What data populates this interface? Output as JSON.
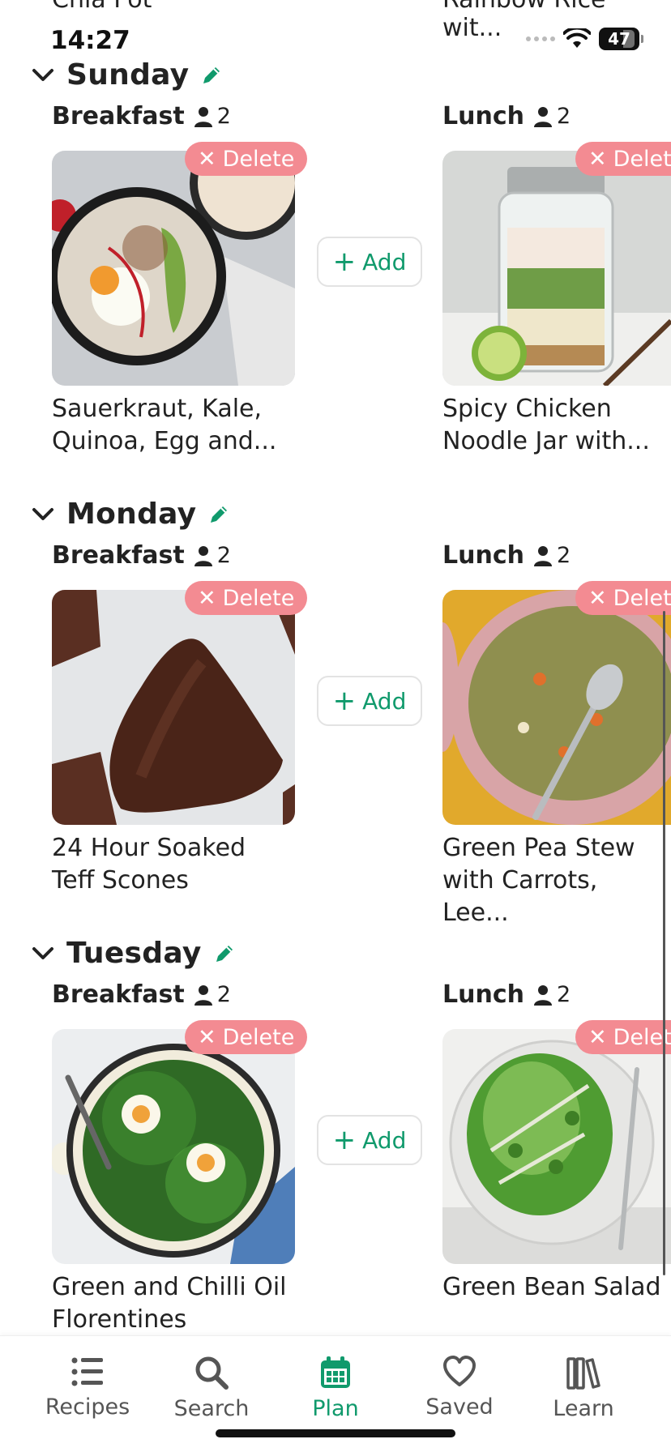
{
  "status_bar": {
    "time": "14:27",
    "battery": "47"
  },
  "previous_row_titles": {
    "left": "Chia Pot",
    "right": "Rainbow Rice wit..."
  },
  "labels": {
    "delete": "Delete",
    "add": "Add"
  },
  "colors": {
    "accent": "#109a6c",
    "delete_pill": "#f38b92"
  },
  "days": [
    {
      "name": "Sunday",
      "breakfast": {
        "label": "Breakfast",
        "servings": "2",
        "title_line1": "Sauerkraut, Kale,",
        "title_line2": "Quinoa, Egg and..."
      },
      "lunch": {
        "label": "Lunch",
        "servings": "2",
        "title_line1": "Spicy Chicken",
        "title_line2": "Noodle Jar with..."
      }
    },
    {
      "name": "Monday",
      "breakfast": {
        "label": "Breakfast",
        "servings": "2",
        "title_line1": "24 Hour Soaked",
        "title_line2": "Teff Scones"
      },
      "lunch": {
        "label": "Lunch",
        "servings": "2",
        "title_line1": "Green Pea Stew",
        "title_line2": "with Carrots, Lee..."
      }
    },
    {
      "name": "Tuesday",
      "breakfast": {
        "label": "Breakfast",
        "servings": "2",
        "title_line1": "Green and Chilli Oil",
        "title_line2": "Florentines"
      },
      "lunch": {
        "label": "Lunch",
        "servings": "2",
        "title_line1": "Green Bean Salad",
        "title_line2": ""
      }
    }
  ],
  "tab_bar": {
    "active": "Plan",
    "items": [
      {
        "label": "Recipes",
        "icon": "list-icon"
      },
      {
        "label": "Search",
        "icon": "search-icon"
      },
      {
        "label": "Plan",
        "icon": "calendar-icon"
      },
      {
        "label": "Saved",
        "icon": "heart-icon"
      },
      {
        "label": "Learn",
        "icon": "books-icon"
      }
    ]
  }
}
